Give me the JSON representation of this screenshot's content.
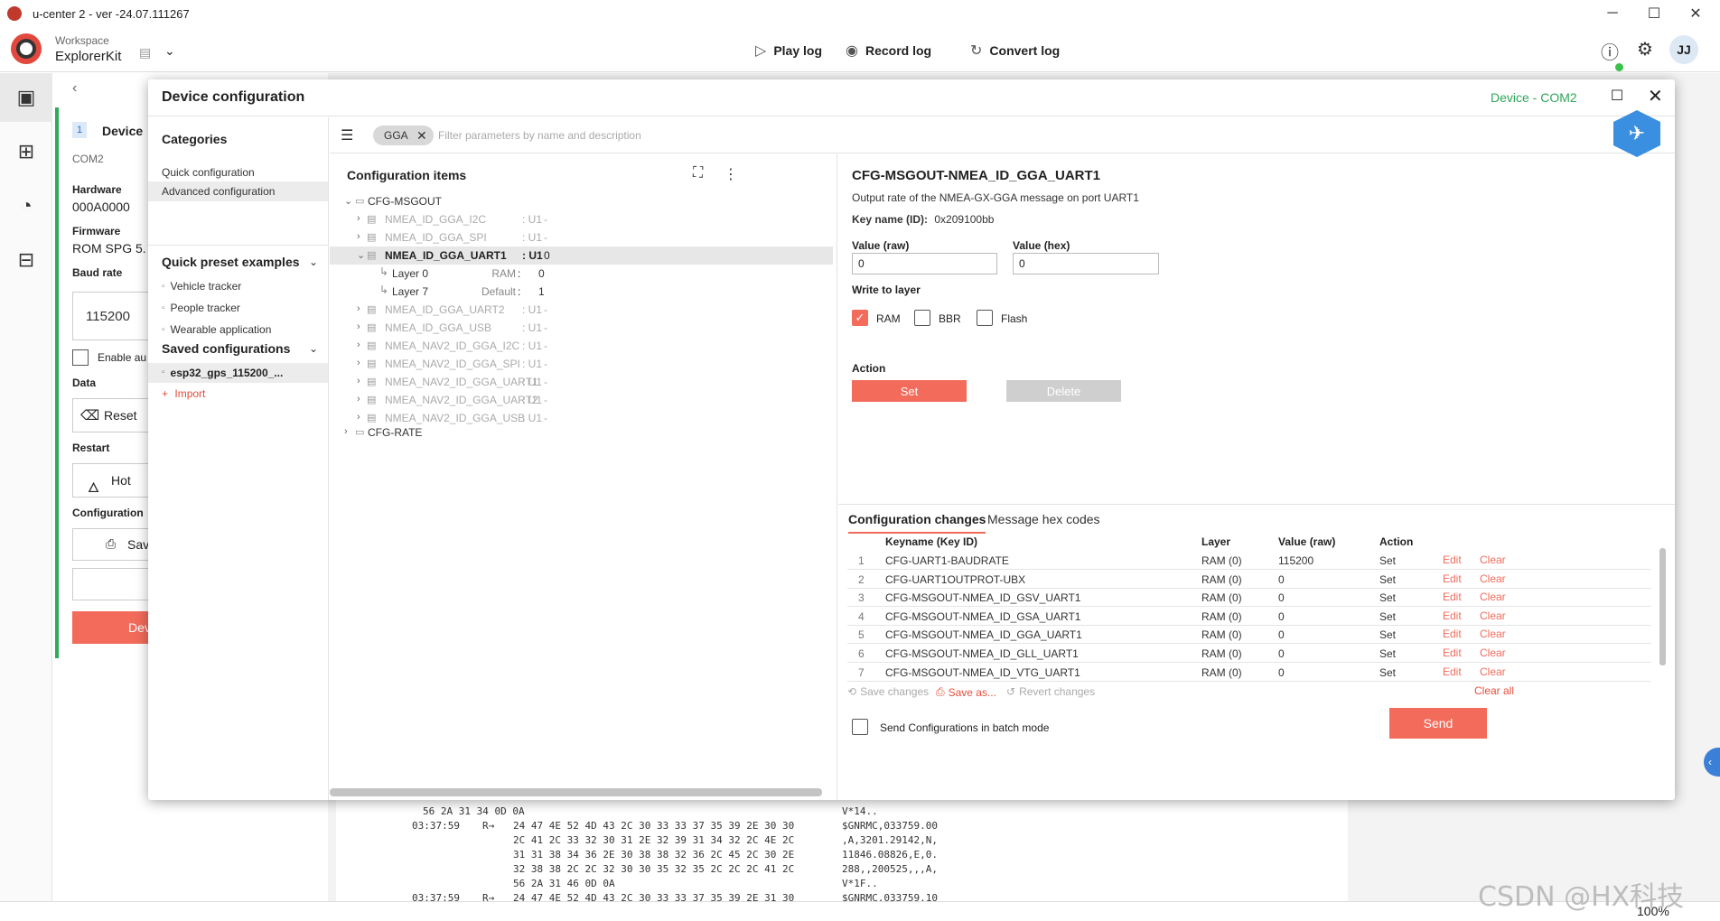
{
  "window": {
    "title": "u-center 2 - ver -24.07.111267",
    "minimize": "─",
    "maximize": "☐",
    "close": "✕"
  },
  "header": {
    "workspace_label": "Workspace",
    "workspace_name": "ExplorerKit",
    "play_log": "Play log",
    "record_log": "Record log",
    "convert_log": "Convert log",
    "avatar": "JJ"
  },
  "background": {
    "back_arrow": "‹",
    "step_num": "1",
    "device_label": "Device",
    "com": "COM2",
    "hardware_label": "Hardware",
    "hardware_value": "000A0000",
    "firmware_label": "Firmware",
    "firmware_value": "ROM SPG 5.",
    "baud_label": "Baud rate",
    "baud_value": "115200",
    "enable_label": "Enable au",
    "data_label": "Data",
    "reset_btn": "Reset",
    "restart_label": "Restart",
    "hot_btn": "Hot",
    "configuration_label": "Configuration",
    "save_btn": "Sav",
    "dev_btn": "Dev",
    "zoom": "100%"
  },
  "console": {
    "lines": [
      {
        "time": "",
        "dir": "",
        "hex": "56 2A 31 34 0D 0A",
        "ascii": "V*14.."
      },
      {
        "time": "03:37:59",
        "dir": "R→",
        "hex": "24 47 4E 52 4D 43 2C 30 33 33 37 35 39 2E 30 30",
        "ascii": "$GNRMC,033759.00"
      },
      {
        "time": "",
        "dir": "",
        "hex": "2C 41 2C 33 32 30 31 2E 32 39 31 34 32 2C 4E 2C",
        "ascii": ",A,3201.29142,N,"
      },
      {
        "time": "",
        "dir": "",
        "hex": "31 31 38 34 36 2E 30 38 38 32 36 2C 45 2C 30 2E",
        "ascii": "11846.08826,E,0."
      },
      {
        "time": "",
        "dir": "",
        "hex": "32 38 38 2C 2C 32 30 30 35 32 35 2C 2C 2C 41 2C",
        "ascii": "288,,200525,,,A,"
      },
      {
        "time": "",
        "dir": "",
        "hex": "56 2A 31 46 0D 0A",
        "ascii": "V*1F.."
      },
      {
        "time": "03:37:59",
        "dir": "R→",
        "hex": "24 47 4E 52 4D 43 2C 30 33 33 37 35 39 2E 31 30",
        "ascii": "$GNRMC,033759.10"
      }
    ]
  },
  "watermark": "CSDN @HX科技",
  "modal": {
    "title": "Device configuration",
    "device": "Device - COM2",
    "categories_title": "Categories",
    "quick_config": "Quick configuration",
    "advanced_config": "Advanced configuration",
    "quick_preset_title": "Quick preset examples",
    "presets": [
      "Vehicle tracker",
      "People tracker",
      "Wearable application"
    ],
    "saved_title": "Saved configurations",
    "saved_item": "esp32_gps_115200_...",
    "import": "Import",
    "filter_chip": "GGA",
    "filter_placeholder": "Filter parameters by name and description",
    "items_title": "Configuration items",
    "folder_msgout": "CFG-MSGOUT",
    "folder_rate": "CFG-RATE",
    "items": [
      {
        "name": "NMEA_ID_GGA_I2C",
        "type": ": U1",
        "val": "-"
      },
      {
        "name": "NMEA_ID_GGA_SPI",
        "type": ": U1",
        "val": "-"
      },
      {
        "name": "NMEA_ID_GGA_UART1",
        "type": ": U1",
        "val": "0"
      },
      {
        "name": "NMEA_ID_GGA_UART2",
        "type": ": U1",
        "val": "-"
      },
      {
        "name": "NMEA_ID_GGA_USB",
        "type": ": U1",
        "val": "-"
      },
      {
        "name": "NMEA_NAV2_ID_GGA_I2C",
        "type": ": U1",
        "val": "-"
      },
      {
        "name": "NMEA_NAV2_ID_GGA_SPI",
        "type": ": U1",
        "val": "-"
      },
      {
        "name": "NMEA_NAV2_ID_GGA_UART1",
        "type": ": U1",
        "val": "-"
      },
      {
        "name": "NMEA_NAV2_ID_GGA_UART2",
        "type": ": U1",
        "val": "-"
      },
      {
        "name": "NMEA_NAV2_ID_GGA_USB",
        "type": ": U1",
        "val": "-"
      }
    ],
    "layers": [
      {
        "name": "Layer 0",
        "label": "RAM",
        "sep": ":",
        "val": "0"
      },
      {
        "name": "Layer 7",
        "label": "Default",
        "sep": ":",
        "val": "1"
      }
    ],
    "detail": {
      "title": "CFG-MSGOUT-NMEA_ID_GGA_UART1",
      "desc": "Output rate of the NMEA-GX-GGA message on port UART1",
      "key_label": "Key name (ID):",
      "key_value": "0x209100bb",
      "value_raw_label": "Value (raw)",
      "value_raw": "0",
      "value_hex_label": "Value (hex)",
      "value_hex": "0",
      "write_label": "Write to layer",
      "ram": "RAM",
      "bbr": "BBR",
      "flash": "Flash",
      "action_label": "Action",
      "set": "Set",
      "delete": "Delete"
    },
    "changes": {
      "tab_changes": "Configuration changes",
      "tab_hex": "Message hex codes",
      "col_key": "Keyname (Key ID)",
      "col_layer": "Layer",
      "col_value": "Value (raw)",
      "col_action": "Action",
      "rows": [
        {
          "num": "1",
          "key": "CFG-UART1-BAUDRATE",
          "layer": "RAM (0)",
          "value": "115200",
          "action": "Set",
          "edit": "Edit",
          "clear": "Clear"
        },
        {
          "num": "2",
          "key": "CFG-UART1OUTPROT-UBX",
          "layer": "RAM (0)",
          "value": "0",
          "action": "Set",
          "edit": "Edit",
          "clear": "Clear"
        },
        {
          "num": "3",
          "key": "CFG-MSGOUT-NMEA_ID_GSV_UART1",
          "layer": "RAM (0)",
          "value": "0",
          "action": "Set",
          "edit": "Edit",
          "clear": "Clear"
        },
        {
          "num": "4",
          "key": "CFG-MSGOUT-NMEA_ID_GSA_UART1",
          "layer": "RAM (0)",
          "value": "0",
          "action": "Set",
          "edit": "Edit",
          "clear": "Clear"
        },
        {
          "num": "5",
          "key": "CFG-MSGOUT-NMEA_ID_GGA_UART1",
          "layer": "RAM (0)",
          "value": "0",
          "action": "Set",
          "edit": "Edit",
          "clear": "Clear"
        },
        {
          "num": "6",
          "key": "CFG-MSGOUT-NMEA_ID_GLL_UART1",
          "layer": "RAM (0)",
          "value": "0",
          "action": "Set",
          "edit": "Edit",
          "clear": "Clear"
        },
        {
          "num": "7",
          "key": "CFG-MSGOUT-NMEA_ID_VTG_UART1",
          "layer": "RAM (0)",
          "value": "0",
          "action": "Set",
          "edit": "Edit",
          "clear": "Clear"
        }
      ],
      "save_changes": "Save changes",
      "save_as": "Save as...",
      "revert": "Revert changes",
      "clear_all": "Clear all",
      "batch": "Send Configurations in batch mode",
      "send": "Send"
    }
  }
}
